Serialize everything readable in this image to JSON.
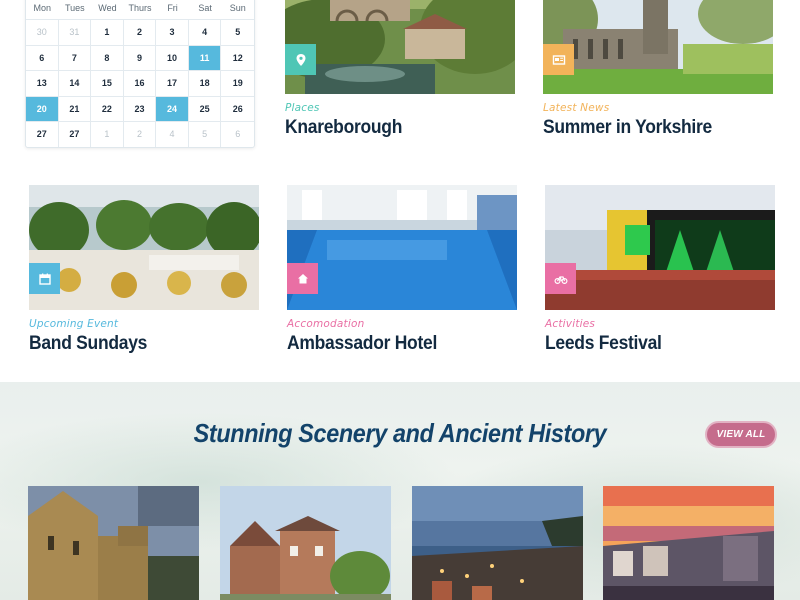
{
  "calendar": {
    "weekdays": [
      "Mon",
      "Tues",
      "Wed",
      "Thurs",
      "Fri",
      "Sat",
      "Sun"
    ],
    "days": [
      {
        "d": "30",
        "state": "muted"
      },
      {
        "d": "31",
        "state": "muted"
      },
      {
        "d": "1"
      },
      {
        "d": "2"
      },
      {
        "d": "3"
      },
      {
        "d": "4"
      },
      {
        "d": "5"
      },
      {
        "d": "6"
      },
      {
        "d": "7"
      },
      {
        "d": "8"
      },
      {
        "d": "9"
      },
      {
        "d": "10"
      },
      {
        "d": "11",
        "state": "active"
      },
      {
        "d": "12"
      },
      {
        "d": "13"
      },
      {
        "d": "14"
      },
      {
        "d": "15"
      },
      {
        "d": "16"
      },
      {
        "d": "17"
      },
      {
        "d": "18"
      },
      {
        "d": "19"
      },
      {
        "d": "20",
        "state": "active"
      },
      {
        "d": "21"
      },
      {
        "d": "22"
      },
      {
        "d": "23"
      },
      {
        "d": "24",
        "state": "active"
      },
      {
        "d": "25"
      },
      {
        "d": "26"
      },
      {
        "d": "27"
      },
      {
        "d": "27"
      },
      {
        "d": "1",
        "state": "muted"
      },
      {
        "d": "2",
        "state": "muted"
      },
      {
        "d": "4",
        "state": "muted"
      },
      {
        "d": "5",
        "state": "muted"
      },
      {
        "d": "6",
        "state": "muted"
      }
    ]
  },
  "cards": {
    "knaresborough": {
      "category": "Places",
      "title": "Knareborough",
      "icon": "location-pin-icon",
      "color": "#4fc6b5"
    },
    "summer": {
      "category": "Latest News",
      "title": "Summer in Yorkshire",
      "icon": "newspaper-icon",
      "color": "#f2b35a"
    },
    "band": {
      "category": "Upcoming Event",
      "title": "Band Sundays",
      "icon": "calendar-icon",
      "color": "#56b9dd"
    },
    "hotel": {
      "category": "Accomodation",
      "title": "Ambassador Hotel",
      "icon": "home-icon",
      "color": "#e96fa4"
    },
    "leeds": {
      "category": "Activities",
      "title": "Leeds Festival",
      "icon": "bicycle-icon",
      "color": "#e96fa4"
    }
  },
  "section": {
    "title": "Stunning Scenery and Ancient History",
    "view_all": "VIEW ALL"
  },
  "colors": {
    "active_day": "#56b9dd",
    "heading": "#13436a",
    "view_all_button": "#c56c8c"
  }
}
